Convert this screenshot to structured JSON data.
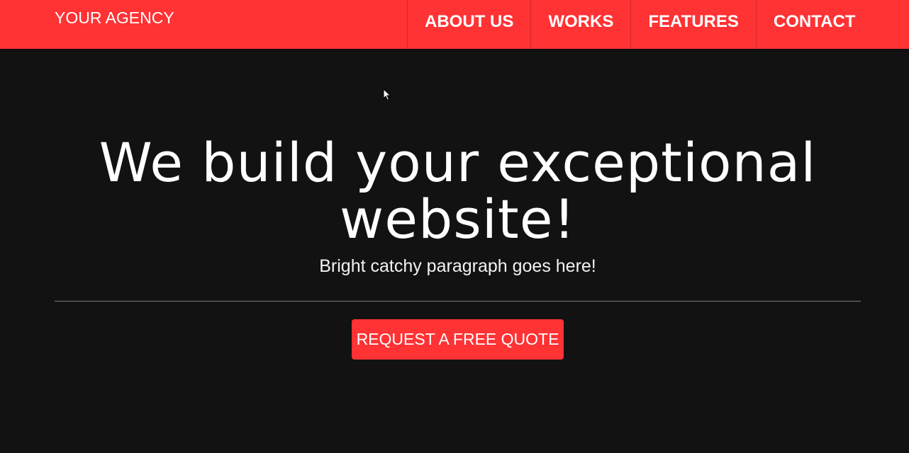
{
  "header": {
    "brand": "YOUR AGENCY",
    "nav": [
      {
        "label": "ABOUT US"
      },
      {
        "label": "WORKS"
      },
      {
        "label": "FEATURES"
      },
      {
        "label": "CONTACT"
      }
    ]
  },
  "hero": {
    "title": "We build your exceptional website!",
    "subtitle": "Bright catchy paragraph goes here!",
    "cta_label": "REQUEST A FREE QUOTE"
  },
  "icons": {
    "cursor": "mouse-pointer-icon"
  },
  "colors": {
    "accent": "#ff3234",
    "background": "#121212",
    "text": "#ffffff",
    "divider": "#7a7a7a"
  }
}
